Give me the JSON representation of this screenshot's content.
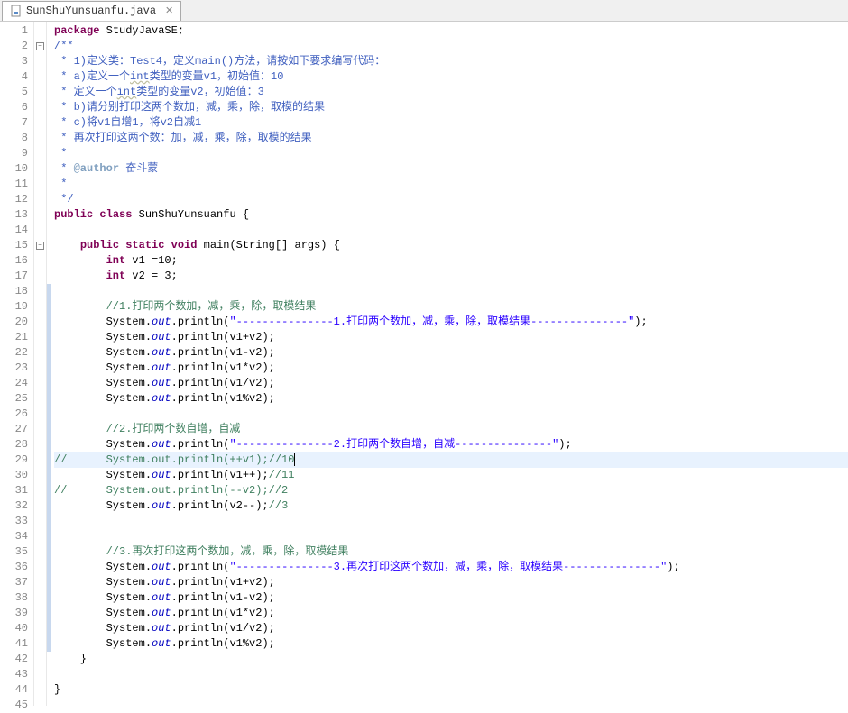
{
  "tab": {
    "filename": "SunShuYunsuanfu.java",
    "close_glyph": "✕"
  },
  "code": {
    "lines": [
      {
        "n": 1,
        "fold": "",
        "change": false,
        "hl": false,
        "segs": [
          [
            "kw",
            "package"
          ],
          [
            "",
            " StudyJavaSE;"
          ]
        ]
      },
      {
        "n": 2,
        "fold": "minus",
        "change": false,
        "hl": false,
        "segs": [
          [
            "comment-blue",
            "/**"
          ]
        ]
      },
      {
        "n": 3,
        "fold": "",
        "change": false,
        "hl": false,
        "segs": [
          [
            "comment-blue",
            " * 1)定义类：Test4，定义main()方法，请按如下要求编写代码："
          ]
        ]
      },
      {
        "n": 4,
        "fold": "",
        "change": false,
        "hl": false,
        "segs": [
          [
            "comment-blue",
            " * a)定义一个"
          ],
          [
            "comment-blue underline",
            "int"
          ],
          [
            "comment-blue",
            "类型的变量v1，初始值：10"
          ]
        ]
      },
      {
        "n": 5,
        "fold": "",
        "change": false,
        "hl": false,
        "segs": [
          [
            "comment-blue",
            " * 定义一个"
          ],
          [
            "comment-blue underline",
            "int"
          ],
          [
            "comment-blue",
            "类型的变量v2，初始值：3"
          ]
        ]
      },
      {
        "n": 6,
        "fold": "",
        "change": false,
        "hl": false,
        "segs": [
          [
            "comment-blue",
            " * b)请分别打印这两个数加，减，乘，除，取模的结果"
          ]
        ]
      },
      {
        "n": 7,
        "fold": "",
        "change": false,
        "hl": false,
        "segs": [
          [
            "comment-blue",
            " * c)将v1自增1，将v2自减1"
          ]
        ]
      },
      {
        "n": 8,
        "fold": "",
        "change": false,
        "hl": false,
        "segs": [
          [
            "comment-blue",
            " * 再次打印这两个数：加，减，乘，除，取模的结果"
          ]
        ]
      },
      {
        "n": 9,
        "fold": "",
        "change": false,
        "hl": false,
        "segs": [
          [
            "comment-blue",
            " * "
          ]
        ]
      },
      {
        "n": 10,
        "fold": "",
        "change": false,
        "hl": false,
        "segs": [
          [
            "comment-blue",
            " * "
          ],
          [
            "tag",
            "@author"
          ],
          [
            "comment-blue",
            " 奋斗蒙"
          ]
        ]
      },
      {
        "n": 11,
        "fold": "",
        "change": false,
        "hl": false,
        "segs": [
          [
            "comment-blue",
            " *"
          ]
        ]
      },
      {
        "n": 12,
        "fold": "",
        "change": false,
        "hl": false,
        "segs": [
          [
            "comment-blue",
            " */"
          ]
        ]
      },
      {
        "n": 13,
        "fold": "",
        "change": false,
        "hl": false,
        "segs": [
          [
            "kw",
            "public"
          ],
          [
            "",
            " "
          ],
          [
            "kw",
            "class"
          ],
          [
            "",
            " SunShuYunsuanfu {"
          ]
        ]
      },
      {
        "n": 14,
        "fold": "",
        "change": false,
        "hl": false,
        "segs": [
          [
            "",
            ""
          ]
        ]
      },
      {
        "n": 15,
        "fold": "minus",
        "change": false,
        "hl": false,
        "segs": [
          [
            "",
            "    "
          ],
          [
            "kw",
            "public"
          ],
          [
            "",
            " "
          ],
          [
            "kw",
            "static"
          ],
          [
            "",
            " "
          ],
          [
            "kw",
            "void"
          ],
          [
            "",
            " main(String[] args) {"
          ]
        ]
      },
      {
        "n": 16,
        "fold": "",
        "change": false,
        "hl": false,
        "segs": [
          [
            "",
            "        "
          ],
          [
            "kw",
            "int"
          ],
          [
            "",
            " v1 =10;"
          ]
        ]
      },
      {
        "n": 17,
        "fold": "",
        "change": false,
        "hl": false,
        "segs": [
          [
            "",
            "        "
          ],
          [
            "kw",
            "int"
          ],
          [
            "",
            " v2 = 3;"
          ]
        ]
      },
      {
        "n": 18,
        "fold": "",
        "change": true,
        "hl": false,
        "segs": [
          [
            "",
            "        "
          ]
        ]
      },
      {
        "n": 19,
        "fold": "",
        "change": true,
        "hl": false,
        "segs": [
          [
            "",
            "        "
          ],
          [
            "comment-green",
            "//1.打印两个数加，减，乘，除，取模结果"
          ]
        ]
      },
      {
        "n": 20,
        "fold": "",
        "change": true,
        "hl": false,
        "segs": [
          [
            "",
            "        System."
          ],
          [
            "static-field",
            "out"
          ],
          [
            "",
            ".println("
          ],
          [
            "string",
            "\"---------------1.打印两个数加，减，乘，除，取模结果---------------\""
          ],
          [
            "",
            ");"
          ]
        ]
      },
      {
        "n": 21,
        "fold": "",
        "change": true,
        "hl": false,
        "segs": [
          [
            "",
            "        System."
          ],
          [
            "static-field",
            "out"
          ],
          [
            "",
            ".println(v1+v2);"
          ]
        ]
      },
      {
        "n": 22,
        "fold": "",
        "change": true,
        "hl": false,
        "segs": [
          [
            "",
            "        System."
          ],
          [
            "static-field",
            "out"
          ],
          [
            "",
            ".println(v1-v2);"
          ]
        ]
      },
      {
        "n": 23,
        "fold": "",
        "change": true,
        "hl": false,
        "segs": [
          [
            "",
            "        System."
          ],
          [
            "static-field",
            "out"
          ],
          [
            "",
            ".println(v1*v2);"
          ]
        ]
      },
      {
        "n": 24,
        "fold": "",
        "change": true,
        "hl": false,
        "segs": [
          [
            "",
            "        System."
          ],
          [
            "static-field",
            "out"
          ],
          [
            "",
            ".println(v1/v2);"
          ]
        ]
      },
      {
        "n": 25,
        "fold": "",
        "change": true,
        "hl": false,
        "segs": [
          [
            "",
            "        System."
          ],
          [
            "static-field",
            "out"
          ],
          [
            "",
            ".println(v1%v2);"
          ]
        ]
      },
      {
        "n": 26,
        "fold": "",
        "change": true,
        "hl": false,
        "segs": [
          [
            "",
            "        "
          ]
        ]
      },
      {
        "n": 27,
        "fold": "",
        "change": true,
        "hl": false,
        "segs": [
          [
            "",
            "        "
          ],
          [
            "comment-green",
            "//2.打印两个数自增，自减"
          ]
        ]
      },
      {
        "n": 28,
        "fold": "",
        "change": true,
        "hl": false,
        "segs": [
          [
            "",
            "        System."
          ],
          [
            "static-field",
            "out"
          ],
          [
            "",
            ".println("
          ],
          [
            "string",
            "\"---------------2.打印两个数自增，自减---------------\""
          ],
          [
            "",
            ");"
          ]
        ]
      },
      {
        "n": 29,
        "fold": "",
        "change": true,
        "hl": true,
        "segs": [
          [
            "comment-green",
            "//      System.out.println(++v1);//10"
          ]
        ]
      },
      {
        "n": 30,
        "fold": "",
        "change": true,
        "hl": false,
        "segs": [
          [
            "",
            "        System."
          ],
          [
            "static-field",
            "out"
          ],
          [
            "",
            ".println(v1++);"
          ],
          [
            "comment-green",
            "//11"
          ]
        ]
      },
      {
        "n": 31,
        "fold": "",
        "change": true,
        "hl": false,
        "segs": [
          [
            "comment-green",
            "//      System.out.println(--v2);//2"
          ]
        ]
      },
      {
        "n": 32,
        "fold": "",
        "change": true,
        "hl": false,
        "segs": [
          [
            "",
            "        System."
          ],
          [
            "static-field",
            "out"
          ],
          [
            "",
            ".println(v2--);"
          ],
          [
            "comment-green",
            "//3"
          ]
        ]
      },
      {
        "n": 33,
        "fold": "",
        "change": true,
        "hl": false,
        "segs": [
          [
            "",
            "        "
          ]
        ]
      },
      {
        "n": 34,
        "fold": "",
        "change": true,
        "hl": false,
        "segs": [
          [
            "",
            "        "
          ]
        ]
      },
      {
        "n": 35,
        "fold": "",
        "change": true,
        "hl": false,
        "segs": [
          [
            "",
            "        "
          ],
          [
            "comment-green",
            "//3.再次打印这两个数加，减，乘，除，取模结果"
          ]
        ]
      },
      {
        "n": 36,
        "fold": "",
        "change": true,
        "hl": false,
        "segs": [
          [
            "",
            "        System."
          ],
          [
            "static-field",
            "out"
          ],
          [
            "",
            ".println("
          ],
          [
            "string",
            "\"---------------3.再次打印这两个数加，减，乘，除，取模结果---------------\""
          ],
          [
            "",
            ");"
          ]
        ]
      },
      {
        "n": 37,
        "fold": "",
        "change": true,
        "hl": false,
        "segs": [
          [
            "",
            "        System."
          ],
          [
            "static-field",
            "out"
          ],
          [
            "",
            ".println(v1+v2);"
          ]
        ]
      },
      {
        "n": 38,
        "fold": "",
        "change": true,
        "hl": false,
        "segs": [
          [
            "",
            "        System."
          ],
          [
            "static-field",
            "out"
          ],
          [
            "",
            ".println(v1-v2);"
          ]
        ]
      },
      {
        "n": 39,
        "fold": "",
        "change": true,
        "hl": false,
        "segs": [
          [
            "",
            "        System."
          ],
          [
            "static-field",
            "out"
          ],
          [
            "",
            ".println(v1*v2);"
          ]
        ]
      },
      {
        "n": 40,
        "fold": "",
        "change": true,
        "hl": false,
        "segs": [
          [
            "",
            "        System."
          ],
          [
            "static-field",
            "out"
          ],
          [
            "",
            ".println(v1/v2);"
          ]
        ]
      },
      {
        "n": 41,
        "fold": "",
        "change": true,
        "hl": false,
        "segs": [
          [
            "",
            "        System."
          ],
          [
            "static-field",
            "out"
          ],
          [
            "",
            ".println(v1%v2);"
          ]
        ]
      },
      {
        "n": 42,
        "fold": "",
        "change": false,
        "hl": false,
        "segs": [
          [
            "",
            "    }"
          ]
        ]
      },
      {
        "n": 43,
        "fold": "",
        "change": false,
        "hl": false,
        "segs": [
          [
            "",
            ""
          ]
        ]
      },
      {
        "n": 44,
        "fold": "",
        "change": false,
        "hl": false,
        "segs": [
          [
            "",
            "}"
          ]
        ]
      },
      {
        "n": 45,
        "fold": "",
        "change": false,
        "hl": false,
        "segs": [
          [
            "",
            ""
          ]
        ]
      }
    ],
    "cursor_line": 29
  }
}
